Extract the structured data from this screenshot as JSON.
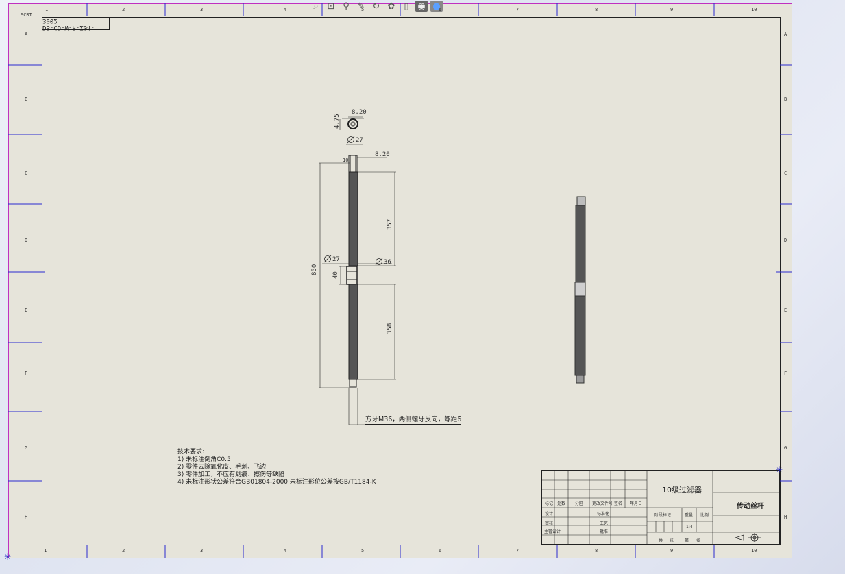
{
  "toolbar": {
    "icons": [
      "zoom-fit-icon",
      "zoom-area-icon",
      "zoom-icon",
      "pan-icon",
      "rotate-icon",
      "palette-icon",
      "view-orientation-icon",
      "display-style-icon",
      "appearance-icon"
    ]
  },
  "drawing": {
    "number": "DB-CD-W-P-Z04-3002",
    "dims": {
      "top_width": "8.20",
      "top_height": "4.75",
      "dia_top": "27",
      "dim_820": "8.20",
      "small_10": "10",
      "len_357": "357",
      "overall_850": "850",
      "dia_mid_left": "27",
      "dia_mid_right": "36",
      "len_40": "40",
      "len_358": "358"
    },
    "callout": "方牙M36，两侧螺牙反向，螺距6",
    "notes": [
      "技术要求:",
      "1) 未标注倒角C0.5",
      "2) 零件去除氧化皮、毛刺、飞边",
      "3) 零件加工，不应有划痕、擦伤等缺陷",
      "4) 未标注形状公差符合GB01804-2000,未标注形位公差按GB/T1184-K"
    ],
    "zones_top": [
      "1",
      "2",
      "3",
      "4",
      "5",
      "6",
      "7",
      "8",
      "9",
      "10"
    ],
    "zones_side": [
      "A",
      "B",
      "C",
      "D",
      "E",
      "F",
      "G",
      "H"
    ],
    "sheet_label": "SCRT"
  },
  "title_block": {
    "company": "10级过滤器",
    "part_name": "传动丝杆",
    "row_labels": [
      "标记",
      "处数",
      "分区",
      "更改文件号",
      "签名",
      "年月日"
    ],
    "left_labels": [
      "设计",
      "审核",
      "主管设计"
    ],
    "mid_labels": [
      "标准化",
      "工艺",
      "批准"
    ],
    "stage_labels": [
      "阶段标记",
      "重量",
      "比例"
    ],
    "scale": "1:4",
    "sheet_info": [
      "共",
      "张",
      "第",
      "张"
    ]
  }
}
